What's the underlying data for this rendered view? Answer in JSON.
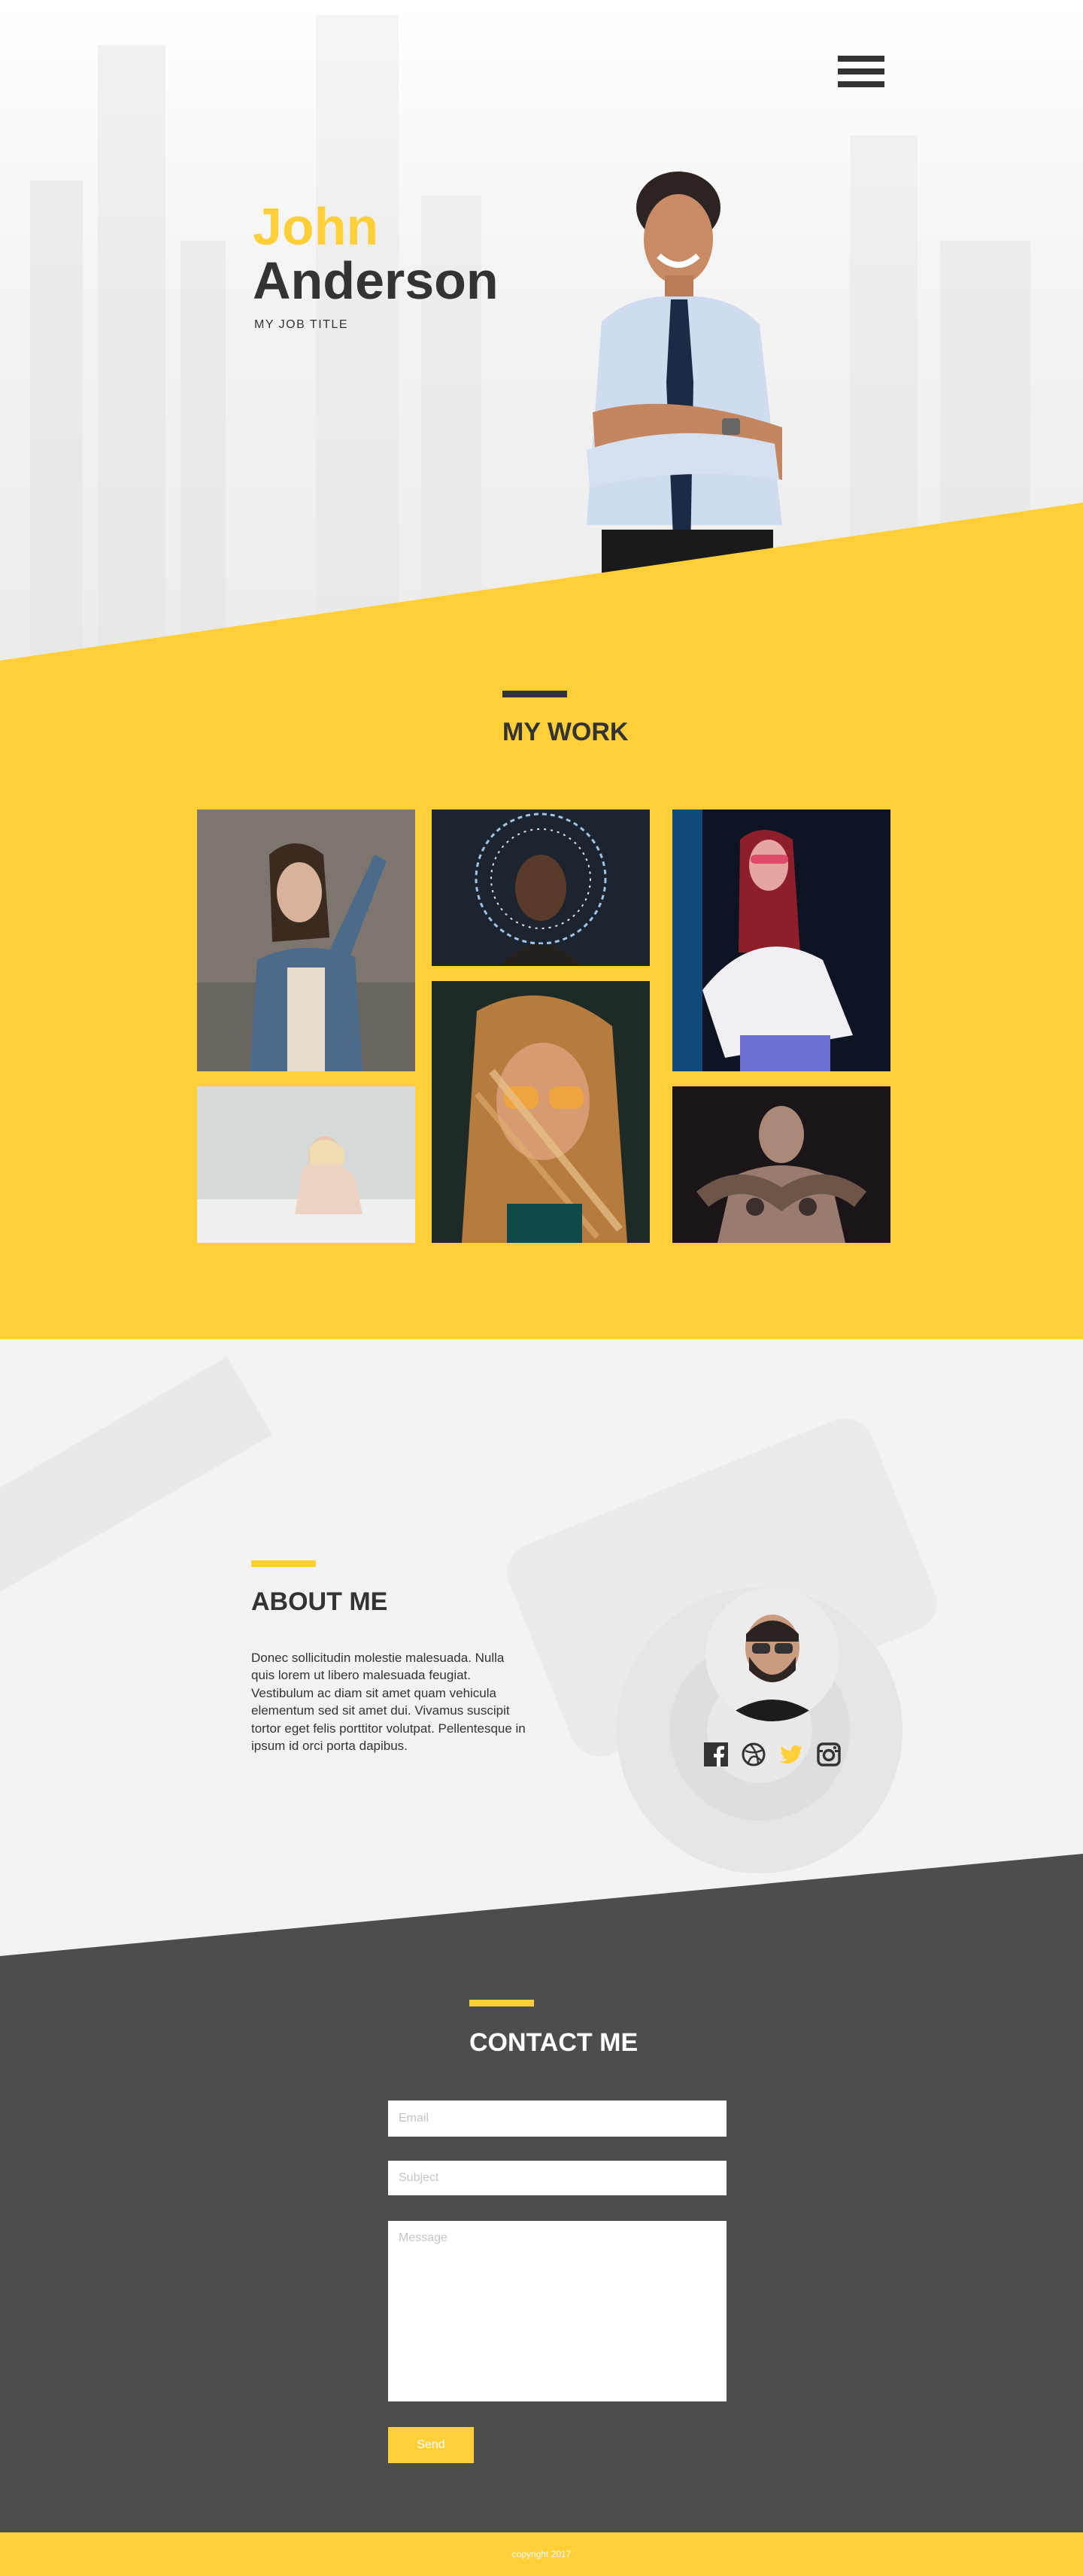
{
  "hero": {
    "first_name": "John",
    "last_name": "Anderson",
    "job_title": "MY JOB TITLE"
  },
  "nav": {
    "menu_icon": "hamburger-menu-icon"
  },
  "work": {
    "title": "MY WORK",
    "tiles": [
      {
        "subject": "woman in denim jacket posing"
      },
      {
        "subject": "woman with sparkler light trails"
      },
      {
        "subject": "woman with red hair and sunglasses"
      },
      {
        "subject": "woman sitting on bed"
      },
      {
        "subject": "woman with orange glasses and hair in motion"
      },
      {
        "subject": "tattooed man"
      }
    ]
  },
  "about": {
    "title": "ABOUT ME",
    "text": "Donec sollicitudin molestie malesuada. Nulla quis lorem ut libero malesuada feugiat. Vestibulum ac diam sit amet quam vehicula elementum sed sit amet dui. Vivamus suscipit tortor eget felis porttitor volutpat. Pellentesque in ipsum id orci porta dapibus.",
    "socials": [
      "facebook-icon",
      "dribbble-icon",
      "twitter-icon",
      "instagram-icon"
    ]
  },
  "contact": {
    "title": "CONTACT ME",
    "email_placeholder": "Email",
    "subject_placeholder": "Subject",
    "message_placeholder": "Message",
    "send_label": "Send"
  },
  "footer": {
    "copyright": "copyright 2017"
  },
  "colors": {
    "accent": "#ffcf3a",
    "dark": "#4d4d4d",
    "text": "#333333"
  }
}
